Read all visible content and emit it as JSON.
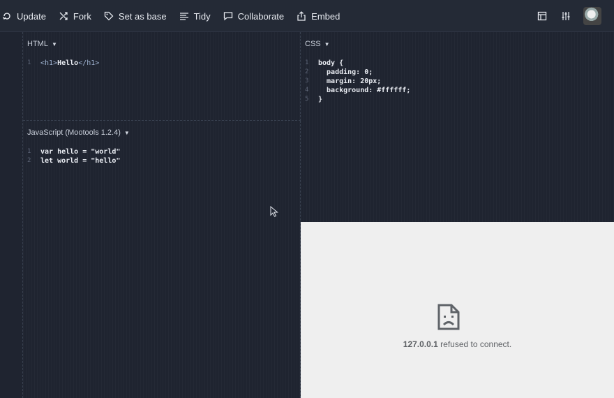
{
  "toolbar": {
    "update_label": "Update",
    "fork_label": "Fork",
    "set_as_base_label": "Set as base",
    "tidy_label": "Tidy",
    "collaborate_label": "Collaborate",
    "embed_label": "Embed",
    "right_icons": [
      "layout-icon",
      "settings-sliders-icon",
      "avatar"
    ]
  },
  "panes": {
    "html": {
      "title": "HTML",
      "lines": [
        {
          "num": "1",
          "open": "<h1>",
          "text": "Hello",
          "close": "</h1>"
        }
      ]
    },
    "css": {
      "title": "CSS",
      "lines": [
        {
          "num": "1",
          "text": "body {"
        },
        {
          "num": "2",
          "text": "  padding: 0;"
        },
        {
          "num": "3",
          "text": "  margin: 20px;"
        },
        {
          "num": "4",
          "text": "  background: #ffffff;"
        },
        {
          "num": "5",
          "text": "}"
        }
      ]
    },
    "js": {
      "title": "JavaScript (Mootools 1.2.4)",
      "lines": [
        {
          "num": "1",
          "text": "var hello = \"world\""
        },
        {
          "num": "2",
          "text": "let world = \"hello\""
        }
      ]
    }
  },
  "preview": {
    "host": "127.0.0.1",
    "message": " refused to connect."
  },
  "colors": {
    "background": "#1f2430",
    "toolbar": "#242a36",
    "preview_bg": "#efefef"
  }
}
